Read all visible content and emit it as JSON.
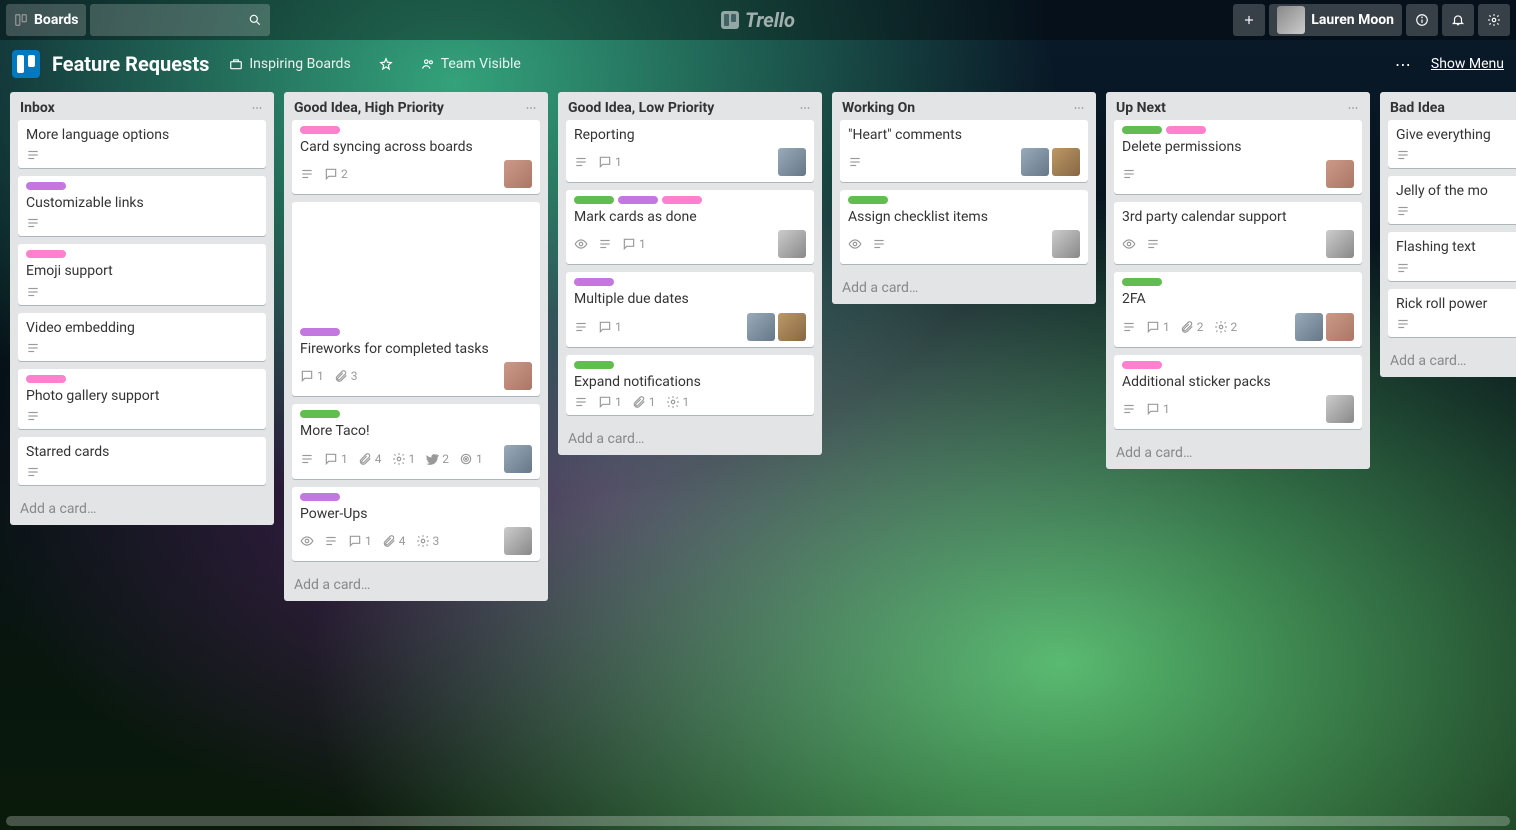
{
  "header": {
    "boards_label": "Boards",
    "logo_text": "Trello",
    "user_name": "Lauren Moon"
  },
  "board_header": {
    "title": "Feature Requests",
    "team_label": "Inspiring Boards",
    "visibility": "Team Visible",
    "show_menu": "Show Menu"
  },
  "add_card_label": "Add a card…",
  "lists": [
    {
      "title": "Inbox",
      "cards": [
        {
          "title": "More language options",
          "labels": [],
          "badges": [
            "desc"
          ],
          "members": []
        },
        {
          "title": "Customizable links",
          "labels": [
            "purple"
          ],
          "badges": [
            "desc"
          ],
          "members": []
        },
        {
          "title": "Emoji support",
          "labels": [
            "pink"
          ],
          "badges": [
            "desc"
          ],
          "members": []
        },
        {
          "title": "Video embedding",
          "labels": [],
          "badges": [
            "desc"
          ],
          "members": []
        },
        {
          "title": "Photo gallery support",
          "labels": [
            "pink"
          ],
          "badges": [
            "desc"
          ],
          "members": []
        },
        {
          "title": "Starred cards",
          "labels": [],
          "badges": [
            "desc"
          ],
          "members": []
        }
      ]
    },
    {
      "title": "Good Idea, High Priority",
      "cards": [
        {
          "title": "Card syncing across boards",
          "labels": [
            "pink"
          ],
          "badges": [
            "desc",
            "comments:2"
          ],
          "members": [
            "m1"
          ]
        },
        {
          "title": "Fireworks for completed tasks",
          "labels": [
            "purple"
          ],
          "cover": true,
          "badges": [
            "comments:1",
            "attach:3"
          ],
          "members": [
            "m1"
          ]
        },
        {
          "title": "More Taco!",
          "labels": [
            "green"
          ],
          "badges": [
            "desc",
            "comments:1",
            "attach:4",
            "gear:1",
            "twitter:2",
            "target:1"
          ],
          "members": [
            "m2"
          ]
        },
        {
          "title": "Power-Ups",
          "labels": [
            "purple"
          ],
          "badges": [
            "eye",
            "desc",
            "comments:1",
            "attach:4",
            "gear:3"
          ],
          "members": [
            "m3"
          ]
        }
      ]
    },
    {
      "title": "Good Idea, Low Priority",
      "cards": [
        {
          "title": "Reporting",
          "labels": [],
          "badges": [
            "desc",
            "comments:1"
          ],
          "members": [
            "m2"
          ]
        },
        {
          "title": "Mark cards as done",
          "labels": [
            "green",
            "purple",
            "pink"
          ],
          "badges": [
            "eye",
            "desc",
            "comments:1"
          ],
          "members": [
            "m3"
          ]
        },
        {
          "title": "Multiple due dates",
          "labels": [
            "purple"
          ],
          "badges": [
            "desc",
            "comments:1"
          ],
          "members": [
            "m2",
            "m4"
          ]
        },
        {
          "title": "Expand notifications",
          "labels": [
            "green"
          ],
          "badges": [
            "desc",
            "comments:1",
            "attach:1",
            "gear:1"
          ],
          "members": []
        }
      ]
    },
    {
      "title": "Working On",
      "cards": [
        {
          "title": "\"Heart\" comments",
          "labels": [],
          "badges": [
            "desc"
          ],
          "members": [
            "m2",
            "m4"
          ]
        },
        {
          "title": "Assign checklist items",
          "labels": [
            "green"
          ],
          "badges": [
            "eye",
            "desc"
          ],
          "members": [
            "m3"
          ]
        }
      ]
    },
    {
      "title": "Up Next",
      "cards": [
        {
          "title": "Delete permissions",
          "labels": [
            "green",
            "pink"
          ],
          "badges": [
            "desc"
          ],
          "members": [
            "m1"
          ]
        },
        {
          "title": "3rd party calendar support",
          "labels": [],
          "badges": [
            "eye",
            "desc"
          ],
          "members": [
            "m3"
          ]
        },
        {
          "title": "2FA",
          "labels": [
            "green"
          ],
          "badges": [
            "desc",
            "comments:1",
            "attach:2",
            "gear:2"
          ],
          "members": [
            "m2",
            "m1"
          ]
        },
        {
          "title": "Additional sticker packs",
          "labels": [
            "pink"
          ],
          "badges": [
            "desc",
            "comments:1"
          ],
          "members": [
            "m3"
          ]
        }
      ]
    },
    {
      "title": "Bad Idea",
      "cards": [
        {
          "title": "Give everything",
          "labels": [],
          "badges": [
            "desc"
          ],
          "members": []
        },
        {
          "title": "Jelly of the mo",
          "labels": [],
          "badges": [
            "desc"
          ],
          "members": []
        },
        {
          "title": "Flashing text",
          "labels": [],
          "badges": [
            "desc"
          ],
          "members": []
        },
        {
          "title": "Rick roll power",
          "labels": [],
          "badges": [
            "desc"
          ],
          "members": []
        }
      ]
    }
  ]
}
